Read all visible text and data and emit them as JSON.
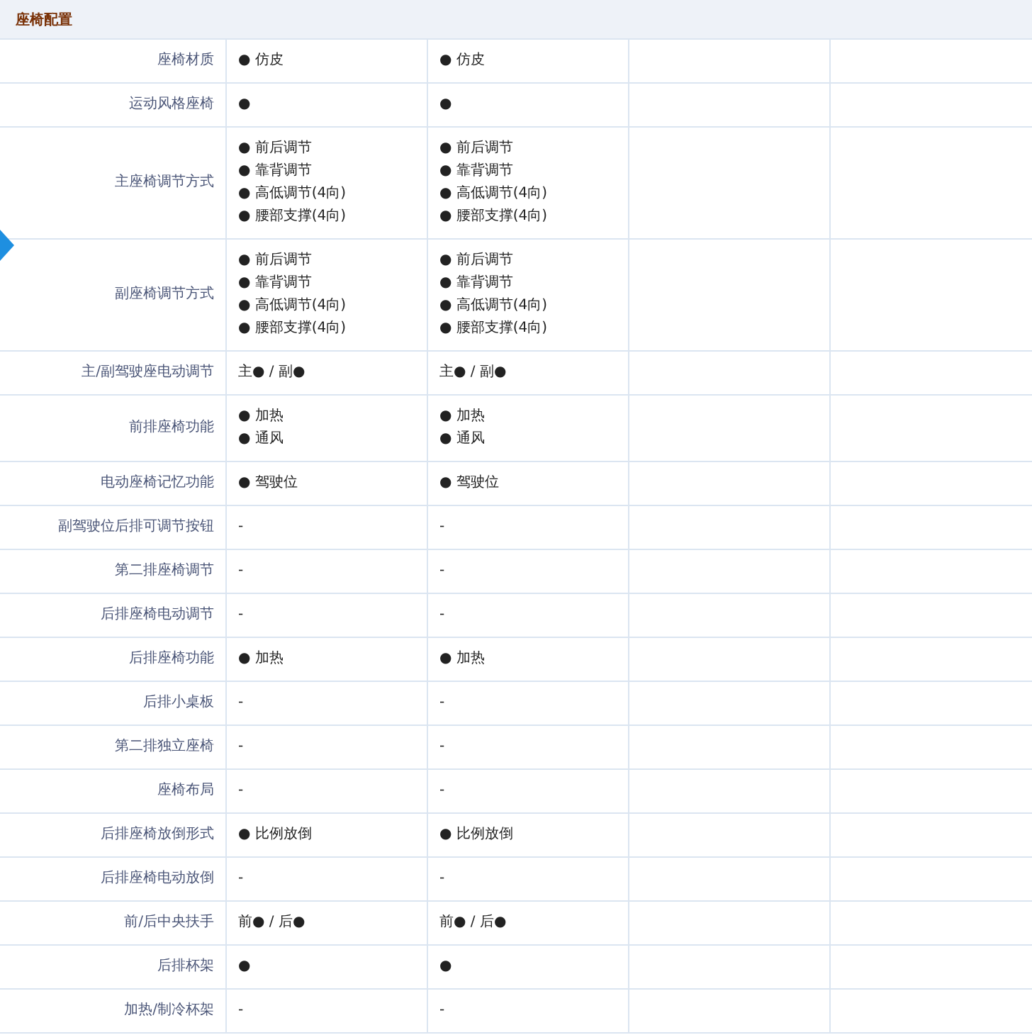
{
  "section": {
    "title": "座椅配置"
  },
  "rows": [
    {
      "label": "座椅材质",
      "values": [
        [
          "● 仿皮"
        ],
        [
          "● 仿皮"
        ]
      ]
    },
    {
      "label": "运动风格座椅",
      "values": [
        [
          "●"
        ],
        [
          "●"
        ]
      ]
    },
    {
      "label": "主座椅调节方式",
      "values": [
        [
          "● 前后调节",
          "● 靠背调节",
          "● 高低调节(4向)",
          "● 腰部支撑(4向)"
        ],
        [
          "● 前后调节",
          "● 靠背调节",
          "● 高低调节(4向)",
          "● 腰部支撑(4向)"
        ]
      ]
    },
    {
      "label": "副座椅调节方式",
      "values": [
        [
          "● 前后调节",
          "● 靠背调节",
          "● 高低调节(4向)",
          "● 腰部支撑(4向)"
        ],
        [
          "● 前后调节",
          "● 靠背调节",
          "● 高低调节(4向)",
          "● 腰部支撑(4向)"
        ]
      ]
    },
    {
      "label": "主/副驾驶座电动调节",
      "values": [
        [
          "主● / 副●"
        ],
        [
          "主● / 副●"
        ]
      ]
    },
    {
      "label": "前排座椅功能",
      "values": [
        [
          "● 加热",
          "● 通风"
        ],
        [
          "● 加热",
          "● 通风"
        ]
      ]
    },
    {
      "label": "电动座椅记忆功能",
      "values": [
        [
          "● 驾驶位"
        ],
        [
          "● 驾驶位"
        ]
      ]
    },
    {
      "label": "副驾驶位后排可调节按钮",
      "values": [
        [
          "-"
        ],
        [
          "-"
        ]
      ]
    },
    {
      "label": "第二排座椅调节",
      "values": [
        [
          "-"
        ],
        [
          "-"
        ]
      ]
    },
    {
      "label": "后排座椅电动调节",
      "values": [
        [
          "-"
        ],
        [
          "-"
        ]
      ]
    },
    {
      "label": "后排座椅功能",
      "values": [
        [
          "● 加热"
        ],
        [
          "● 加热"
        ]
      ]
    },
    {
      "label": "后排小桌板",
      "values": [
        [
          "-"
        ],
        [
          "-"
        ]
      ]
    },
    {
      "label": "第二排独立座椅",
      "values": [
        [
          "-"
        ],
        [
          "-"
        ]
      ]
    },
    {
      "label": "座椅布局",
      "values": [
        [
          "-"
        ],
        [
          "-"
        ]
      ]
    },
    {
      "label": "后排座椅放倒形式",
      "values": [
        [
          "● 比例放倒"
        ],
        [
          "● 比例放倒"
        ]
      ]
    },
    {
      "label": "后排座椅电动放倒",
      "values": [
        [
          "-"
        ],
        [
          "-"
        ]
      ]
    },
    {
      "label": "前/后中央扶手",
      "values": [
        [
          "前● / 后●"
        ],
        [
          "前● / 后●"
        ]
      ]
    },
    {
      "label": "后排杯架",
      "values": [
        [
          "●"
        ],
        [
          "●"
        ]
      ]
    },
    {
      "label": "加热/制冷杯架",
      "values": [
        [
          "-"
        ],
        [
          "-"
        ]
      ]
    }
  ]
}
